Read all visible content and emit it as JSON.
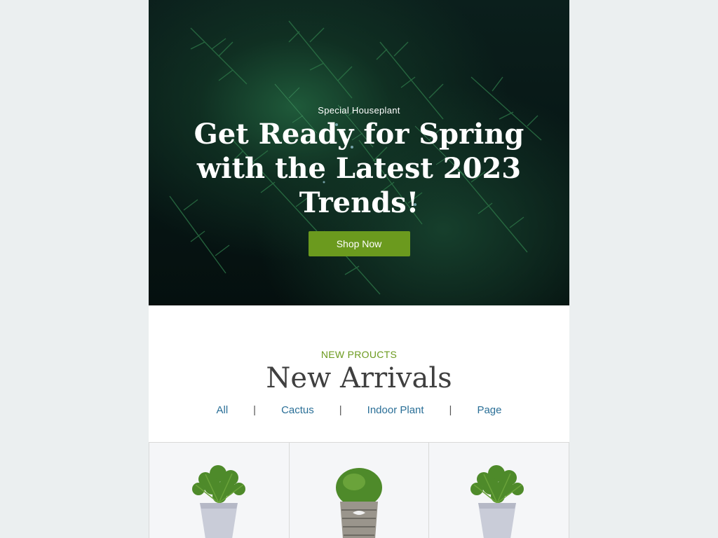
{
  "hero": {
    "eyebrow": "Special Houseplant",
    "title": "Get Ready for Spring with the Latest 2023 Trends!",
    "button_label": "Shop Now"
  },
  "section": {
    "eyebrow": "NEW PROUCTS",
    "title": "New Arrivals",
    "filters": [
      "All",
      "Cactus",
      "Indoor Plant",
      "Page"
    ],
    "separator": "|"
  },
  "colors": {
    "accent": "#6b9a1e",
    "link": "#2a6f97",
    "background": "#ebeff0"
  },
  "products": [
    {
      "icon": "potted-plant-white-pot-icon"
    },
    {
      "icon": "potted-plant-wicker-basket-icon"
    },
    {
      "icon": "potted-plant-white-pot-icon"
    }
  ]
}
